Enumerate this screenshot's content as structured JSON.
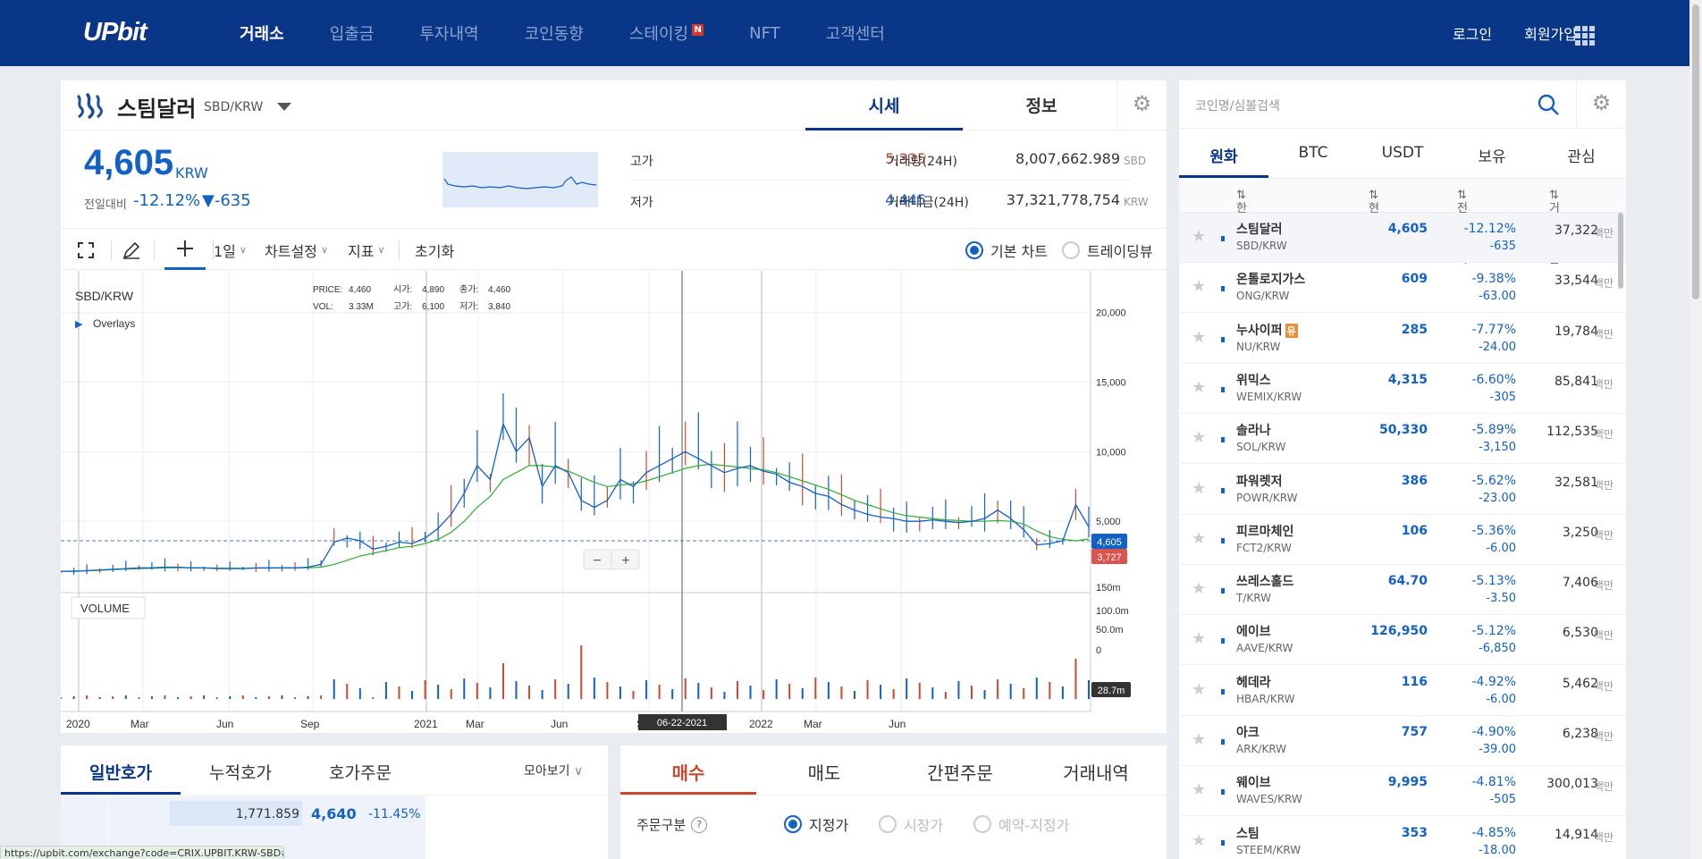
{
  "nav": {
    "logo": "UPbit",
    "items": [
      {
        "label": "거래소",
        "active": true
      },
      {
        "label": "입출금"
      },
      {
        "label": "투자내역"
      },
      {
        "label": "코인동향"
      },
      {
        "label": "스테이킹",
        "badge": "N"
      },
      {
        "label": "NFT"
      },
      {
        "label": "고객센터"
      }
    ],
    "login": "로그인",
    "signup": "회원가입",
    "menu_icon": "grid-icon"
  },
  "coin": {
    "name": "스팀달러",
    "pair": "SBD/KRW",
    "tabs": [
      "시세",
      "정보"
    ],
    "active_tab": "시세",
    "price": "4,605",
    "unit": "KRW",
    "change_label": "전일대비",
    "change_rate": "-12.12%",
    "change_amount": "▼-635",
    "high_label": "고가",
    "high": "5,335",
    "low_label": "저가",
    "low": "4,445",
    "volume_label": "거래량(24H)",
    "volume": "8,007,662.989",
    "volume_unit": "SBD",
    "value_label": "거래대금(24H)",
    "value": "37,321,778,754",
    "value_unit": "KRW"
  },
  "toolbar": {
    "interval": "1일",
    "chart_settings": "차트설정",
    "indicators": "지표",
    "reset": "초기화",
    "basic_chart": "기본 차트",
    "tradingview": "트레이딩뷰"
  },
  "chart_info": {
    "symbol": "SBD/KRW",
    "overlays": "Overlays",
    "price_lbl": "PRICE:",
    "price": "4,460",
    "open_lbl": "시가:",
    "open": "4,890",
    "close_lbl": "종가:",
    "close": "4,460",
    "vol_lbl": "VOL:",
    "vol": "3.33M",
    "high_lbl": "고가:",
    "high": "6,100",
    "low_lbl": "저가:",
    "low": "3,840",
    "volume_label": "VOLUME",
    "current_price_tag": "4,605",
    "ma_tag": "3,727",
    "vol_tag": "28.7m",
    "cursor_date": "06-22-2021",
    "zoom_out": "−",
    "zoom_in": "+"
  },
  "chart_data": {
    "type": "line",
    "title": "",
    "xlabel": "",
    "ylabel": "",
    "x_ticks": [
      "2020",
      "Mar",
      "Jun",
      "Sep",
      "2021",
      "Mar",
      "Jun",
      "Sep",
      "2022",
      "Mar",
      "Jun"
    ],
    "y_ticks": [
      "20,000",
      "15,000",
      "10,000",
      "5,000"
    ],
    "volume_ticks": [
      "150m",
      "100.0m",
      "50.0m",
      "0"
    ],
    "ylim": [
      0,
      23000
    ],
    "series": [
      {
        "values": [
          1400,
          1400,
          1450,
          1500,
          1550,
          1600,
          1650,
          1650,
          1700,
          1700,
          1650,
          1650,
          1600,
          1600,
          1600,
          1650,
          1650,
          1650,
          1650,
          1700,
          1900,
          3500,
          3800,
          3600,
          3000,
          3200,
          3500,
          3400,
          3800,
          4500,
          5500,
          7000,
          9000,
          8000,
          12000,
          10000,
          11000,
          7500,
          9000,
          8500,
          6500,
          6000,
          6500,
          8000,
          7500,
          8500,
          9000,
          9500,
          10000,
          9500,
          9000,
          8500,
          8800,
          9000,
          8600,
          8400,
          7800,
          7500,
          7000,
          6800,
          6200,
          5800,
          5500,
          5300,
          5200,
          5000,
          5000,
          5100,
          5000,
          4900,
          5000,
          5200,
          5800,
          5200,
          4400,
          3300,
          3400,
          3600,
          6200,
          4605
        ]
      },
      {
        "values": [
          1400,
          1420,
          1440,
          1480,
          1520,
          1560,
          1600,
          1620,
          1650,
          1660,
          1660,
          1650,
          1640,
          1630,
          1620,
          1630,
          1640,
          1650,
          1650,
          1660,
          1700,
          1900,
          2200,
          2500,
          2700,
          2900,
          3100,
          3200,
          3400,
          3700,
          4200,
          5000,
          6000,
          6800,
          8000,
          8500,
          9000,
          9000,
          8900,
          8600,
          8200,
          7800,
          7500,
          7600,
          7700,
          7900,
          8200,
          8500,
          8800,
          9000,
          9100,
          9000,
          8900,
          8800,
          8700,
          8500,
          8200,
          7900,
          7600,
          7300,
          6900,
          6500,
          6200,
          5900,
          5600,
          5400,
          5300,
          5200,
          5100,
          5050,
          5000,
          5000,
          5050,
          5000,
          4800,
          4300,
          3900,
          3700,
          3600,
          3727
        ]
      }
    ]
  },
  "orderbook": {
    "tabs": [
      "일반호가",
      "누적호가",
      "호가주문"
    ],
    "view": "모아보기",
    "qty": "1,771.859",
    "price": "4,640",
    "rate": "-11.45%"
  },
  "order": {
    "tabs": [
      "매수",
      "매도",
      "간편주문",
      "거래내역"
    ],
    "type_label": "주문구분",
    "opt_limit": "지정가",
    "opt_market": "시장가",
    "opt_reserved": "예약-지정가"
  },
  "market": {
    "search_placeholder": "코인명/심볼검색",
    "tabs": [
      "원화",
      "BTC",
      "USDT",
      "보유",
      "관심"
    ],
    "col_name": "한글명",
    "col_price": "현재가",
    "col_change": "전일대비",
    "col_volume": "거래대금",
    "rows": [
      {
        "name": "스팀달러",
        "pair": "SBD/KRW",
        "price": "4,605",
        "rate": "-12.12%",
        "amt": "-635",
        "vol": "37,322"
      },
      {
        "name": "온톨로지가스",
        "pair": "ONG/KRW",
        "price": "609",
        "rate": "-9.38%",
        "amt": "-63.00",
        "vol": "33,544"
      },
      {
        "name": "누사이퍼",
        "pair": "NU/KRW",
        "price": "285",
        "rate": "-7.77%",
        "amt": "-24.00",
        "vol": "19,784",
        "badge": "유"
      },
      {
        "name": "위믹스",
        "pair": "WEMIX/KRW",
        "price": "4,315",
        "rate": "-6.60%",
        "amt": "-305",
        "vol": "85,841"
      },
      {
        "name": "솔라나",
        "pair": "SOL/KRW",
        "price": "50,330",
        "rate": "-5.89%",
        "amt": "-3,150",
        "vol": "112,535"
      },
      {
        "name": "파워렛저",
        "pair": "POWR/KRW",
        "price": "386",
        "rate": "-5.62%",
        "amt": "-23.00",
        "vol": "32,581"
      },
      {
        "name": "피르마체인",
        "pair": "FCT2/KRW",
        "price": "106",
        "rate": "-5.36%",
        "amt": "-6.00",
        "vol": "3,250"
      },
      {
        "name": "쓰레스홀드",
        "pair": "T/KRW",
        "price": "64.70",
        "rate": "-5.13%",
        "amt": "-3.50",
        "vol": "7,406"
      },
      {
        "name": "에이브",
        "pair": "AAVE/KRW",
        "price": "126,950",
        "rate": "-5.12%",
        "amt": "-6,850",
        "vol": "6,530"
      },
      {
        "name": "헤데라",
        "pair": "HBAR/KRW",
        "price": "116",
        "rate": "-4.92%",
        "amt": "-6.00",
        "vol": "5,462"
      },
      {
        "name": "아크",
        "pair": "ARK/KRW",
        "price": "757",
        "rate": "-4.90%",
        "amt": "-39.00",
        "vol": "6,238"
      },
      {
        "name": "웨이브",
        "pair": "WAVES/KRW",
        "price": "9,995",
        "rate": "-4.81%",
        "amt": "-505",
        "vol": "300,013"
      },
      {
        "name": "스팀",
        "pair": "STEEM/KRW",
        "price": "353",
        "rate": "-4.85%",
        "amt": "-18.00",
        "vol": "14,914"
      }
    ],
    "vol_unit": "백만"
  },
  "status_url": "https://upbit.com/exchange?code=CRIX.UPBIT.KRW-SBD#",
  "colors": {
    "brand": "#093687",
    "down": "#1261c4",
    "up": "#c84a31"
  }
}
